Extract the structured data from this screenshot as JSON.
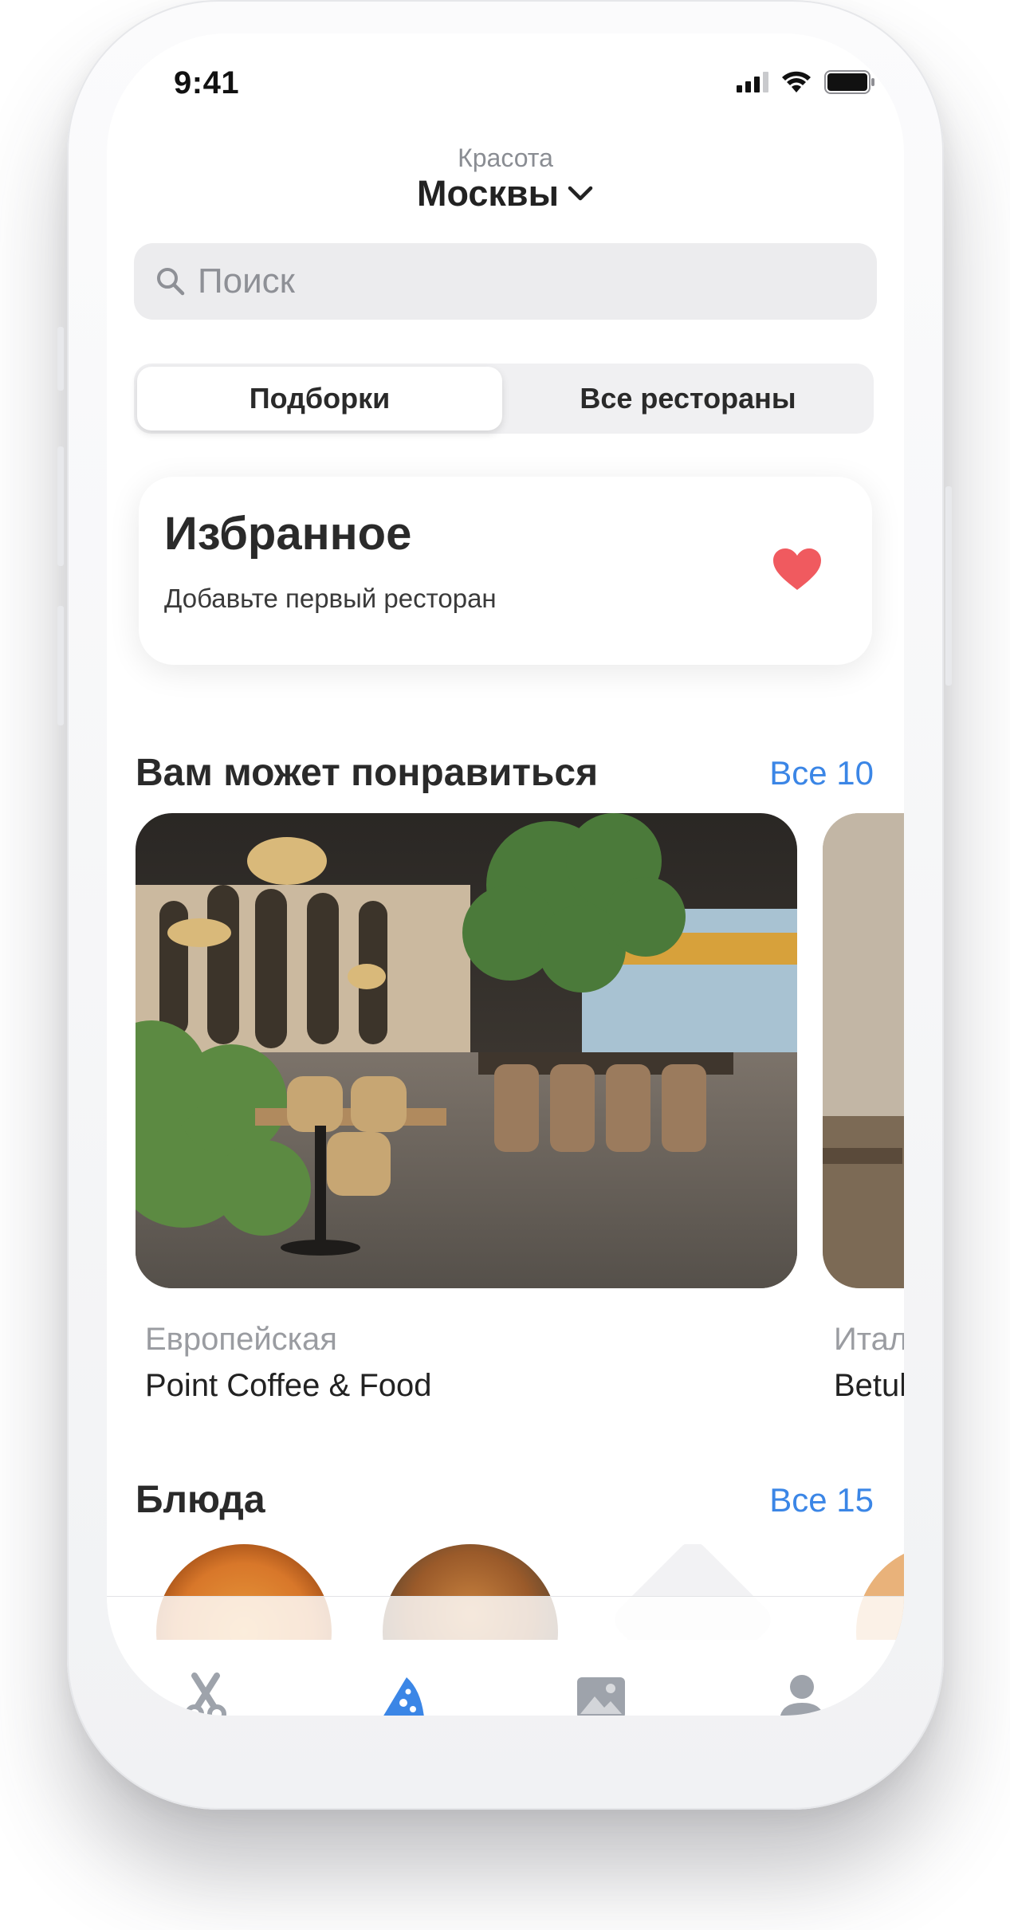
{
  "status_bar": {
    "time": "9:41"
  },
  "header": {
    "subtitle": "Красота",
    "city": "Москвы"
  },
  "search": {
    "placeholder": "Поиск"
  },
  "segmented": {
    "active": "Подборки",
    "inactive": "Все рестораны"
  },
  "favorites": {
    "title": "Избранное",
    "subtitle": "Добавьте первый ресторан"
  },
  "recommended": {
    "title": "Вам может понравиться",
    "link": "Все 10",
    "items": [
      {
        "cuisine": "Европейская",
        "name": "Point Coffee & Food"
      },
      {
        "cuisine": "Итал",
        "name": "Betul"
      }
    ]
  },
  "dishes": {
    "title": "Блюда",
    "link": "Все 15"
  },
  "tabbar": {
    "items": [
      "scissors-icon",
      "pizza-icon",
      "gallery-icon",
      "profile-icon"
    ],
    "active_index": 1
  },
  "colors": {
    "accent": "#3b86e6",
    "heart": "#f05a5f",
    "tab_inactive": "#9ea3ab"
  }
}
